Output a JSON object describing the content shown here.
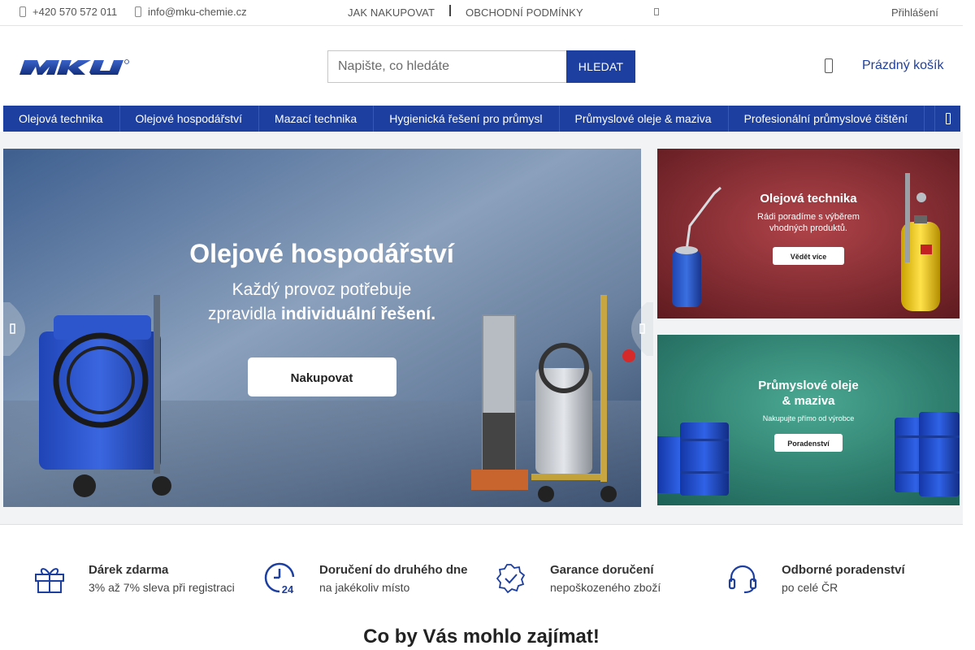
{
  "topbar": {
    "phone": "+420 570 572 011",
    "email": "info@mku-chemie.cz",
    "how_to_buy": "JAK NAKUPOVAT",
    "terms": "OBCHODNÍ PODMÍNKY",
    "login": "Přihlášení"
  },
  "header": {
    "logo_text": "MKU",
    "search_placeholder": "Napište, co hledáte",
    "search_button": "HLEDAT",
    "cart_label": "Prázdný košík"
  },
  "nav": {
    "items": [
      "Olejová technika",
      "Olejové hospodářství",
      "Mazací technika",
      "Hygienická řešení pro průmysl",
      "Průmyslové oleje & maziva",
      "Profesionální průmyslové čištění"
    ]
  },
  "slider": {
    "title": "Olejové hospodářství",
    "line1": "Každý provoz potřebuje",
    "line2_pre": "zpravidla ",
    "line2_bold": "individuální řešení.",
    "button": "Nakupovat"
  },
  "banner1": {
    "title": "Olejová technika",
    "line1": "Rádi poradíme s výběrem",
    "line2": "vhodných produktů.",
    "button": "Vědět více"
  },
  "banner2": {
    "title1": "Průmyslové oleje",
    "title2": "& maziva",
    "sub": "Nakupujte přímo od výrobce",
    "button": "Poradenství"
  },
  "benefits": [
    {
      "title": "Dárek zdarma",
      "sub": "3% až 7% sleva při registraci",
      "icon": "gift-icon"
    },
    {
      "title": "Doručení do druhého dne",
      "sub": "na jakékoliv místo",
      "icon": "clock-24-icon"
    },
    {
      "title": "Garance doručení",
      "sub": "nepoškozeného zboží",
      "icon": "badge-check-icon"
    },
    {
      "title": "Odborné poradenství",
      "sub": "po celé ČR",
      "icon": "headset-icon"
    }
  ],
  "section_title": "Co by Vás mohlo zajímat!",
  "colors": {
    "brand_blue": "#1d3fa0",
    "banner1_bg": "#8e2a2d",
    "banner2_bg": "#2f8a78"
  }
}
